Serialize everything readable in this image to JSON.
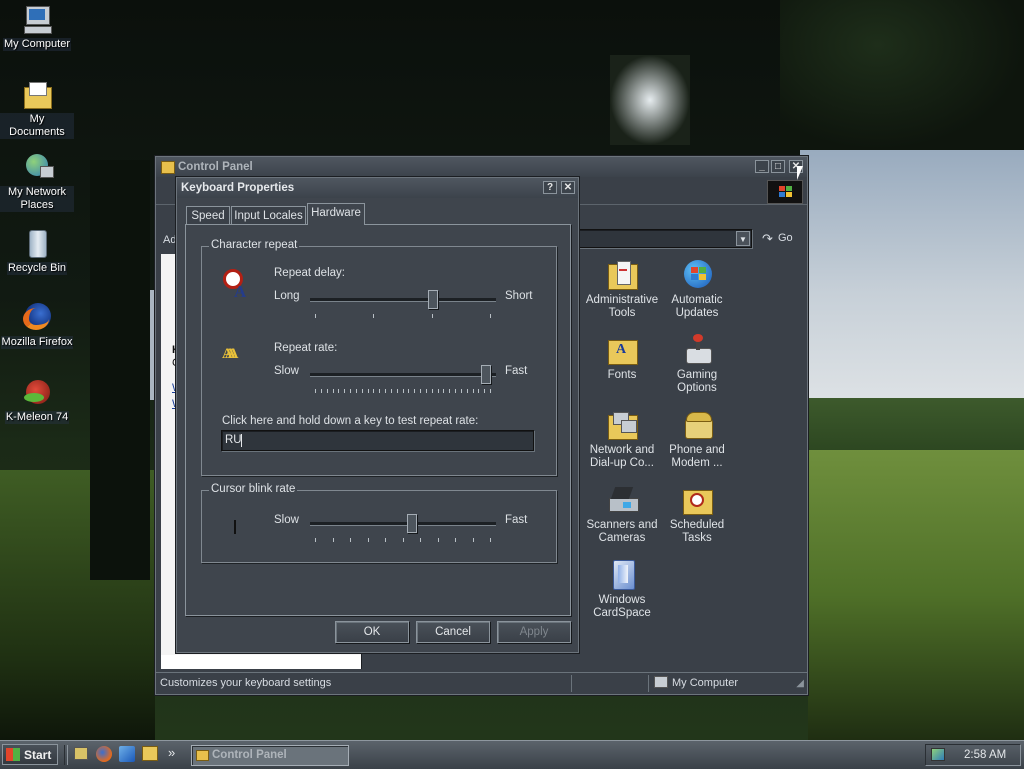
{
  "desktop": {
    "icons": [
      {
        "label": "My Computer",
        "icon": "my-computer-icon"
      },
      {
        "label": "My Documents",
        "icon": "my-documents-icon"
      },
      {
        "label": "My Network Places",
        "icon": "network-places-icon"
      },
      {
        "label": "Recycle Bin",
        "icon": "recycle-bin-icon"
      },
      {
        "label": "Mozilla Firefox",
        "icon": "firefox-icon"
      },
      {
        "label": "K-Meleon 74",
        "icon": "k-meleon-icon"
      }
    ]
  },
  "control_panel": {
    "title": "Control Panel",
    "address_partial": "Ad",
    "go_label": "Go",
    "status_text": "Customizes your keyboard settings",
    "status_location": "My Computer",
    "left_fragment_k": "K",
    "left_fragment_c": "C",
    "left_fragment_w1": "W",
    "left_fragment_w2": "W",
    "icons": [
      {
        "label": "Administrative Tools",
        "icon": "administrative-tools-icon"
      },
      {
        "label": "Automatic Updates",
        "icon": "automatic-updates-icon"
      },
      {
        "label": "Fonts",
        "icon": "fonts-folder-icon"
      },
      {
        "label": "Gaming Options",
        "icon": "gaming-options-icon"
      },
      {
        "label": "Network and Dial-up Co...",
        "icon": "network-connections-icon"
      },
      {
        "label": "Phone and Modem ...",
        "icon": "phone-modem-icon"
      },
      {
        "label": "Scanners and Cameras",
        "icon": "scanners-cameras-icon"
      },
      {
        "label": "Scheduled Tasks",
        "icon": "scheduled-tasks-icon"
      },
      {
        "label": "Windows CardSpace",
        "icon": "cardspace-icon"
      }
    ]
  },
  "dialog": {
    "title": "Keyboard Properties",
    "help_btn": "?",
    "close_btn": "✕",
    "tabs": [
      "Speed",
      "Input Locales",
      "Hardware"
    ],
    "active_tab": "Speed",
    "character_repeat": {
      "group_label": "Character repeat",
      "repeat_delay_label": "Repeat delay:",
      "delay_left": "Long",
      "delay_right": "Short",
      "delay_value_fraction": 0.67,
      "repeat_rate_label": "Repeat rate:",
      "rate_left": "Slow",
      "rate_right": "Fast",
      "rate_value_fraction": 0.97,
      "test_label": "Click here and hold down a key to test repeat rate:",
      "test_value": "RU"
    },
    "cursor_blink": {
      "group_label": "Cursor blink rate",
      "left": "Slow",
      "right": "Fast",
      "value_fraction": 0.55
    },
    "buttons": {
      "ok": "OK",
      "cancel": "Cancel",
      "apply": "Apply"
    }
  },
  "taskbar": {
    "start_label": "Start",
    "active_task": "Control Panel",
    "chevron": "»",
    "clock": "2:58 AM"
  },
  "colors": {
    "window_bg": "#3a4048",
    "title_bar": "#4f5760",
    "taskbar": "#4a5159"
  }
}
